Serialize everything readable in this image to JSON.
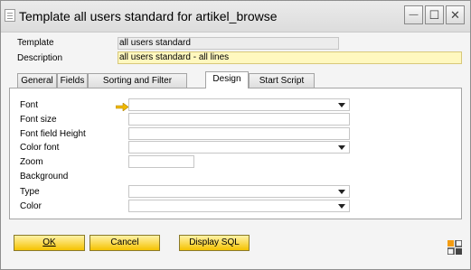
{
  "window": {
    "title": "Template all users standard for  artikel_browse",
    "minimize_symbol": "—",
    "maximize_symbol": "☐",
    "close_symbol": "✕"
  },
  "header": {
    "template_label": "Template",
    "template_value": "all users standard",
    "description_label": "Description",
    "description_value": "all users standard - all lines"
  },
  "tabs": [
    {
      "label": "General",
      "active": false
    },
    {
      "label": "Fields",
      "active": false
    },
    {
      "label": "Sorting and Filter",
      "active": false
    },
    {
      "label": "Design",
      "active": true
    },
    {
      "label": "Start Script",
      "active": false
    }
  ],
  "design": {
    "font_label": "Font",
    "font_value": "",
    "font_size_label": "Font size",
    "font_size_value": "",
    "font_field_height_label": "Font field Height",
    "font_field_height_value": "",
    "color_font_label": "Color font",
    "color_font_value": "",
    "zoom_label": "Zoom",
    "zoom_value": "",
    "background_label": "Background",
    "type_label": "Type",
    "type_value": "",
    "color_label": "Color",
    "color_value": ""
  },
  "buttons": {
    "ok_label": "OK",
    "cancel_label": "Cancel",
    "display_sql_label": "Display SQL"
  },
  "colors": {
    "accent_button": "#f5c200",
    "highlight_field": "#fff8bf",
    "pointer_arrow": "#f0b800",
    "corner_icon": "#f39c12"
  },
  "icons": [
    "window-icon",
    "minimize-icon",
    "maximize-icon",
    "close-icon",
    "chevron-down-icon",
    "pointer-arrow-icon",
    "expand-icon"
  ]
}
